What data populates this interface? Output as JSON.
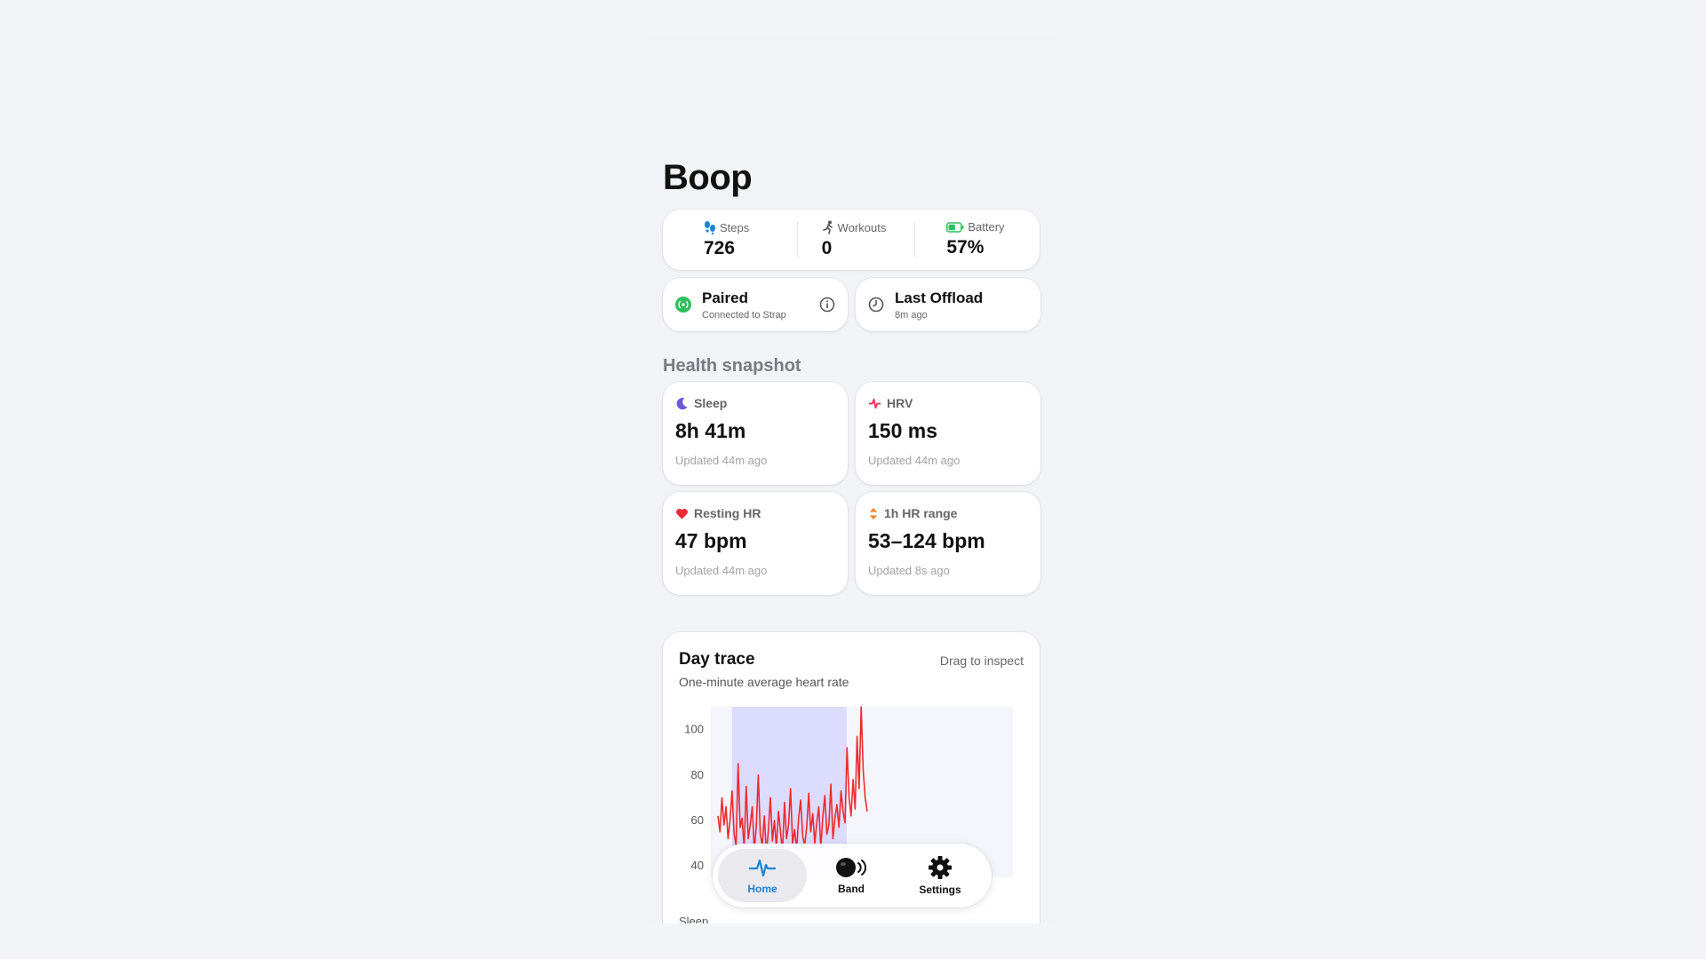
{
  "app": {
    "title": "Boop"
  },
  "stats": [
    {
      "label": "Steps",
      "value": "726",
      "icon": "footprints-icon"
    },
    {
      "label": "Workouts",
      "value": "0",
      "icon": "runner-icon"
    },
    {
      "label": "Battery",
      "value": "57%",
      "icon": "battery-icon",
      "level": 0.57
    }
  ],
  "status": {
    "paired": {
      "title": "Paired",
      "subtitle": "Connected to Strap"
    },
    "offload": {
      "title": "Last Offload",
      "subtitle": "8m ago"
    }
  },
  "health": {
    "section_title": "Health snapshot",
    "sleep": {
      "label": "Sleep",
      "value": "8h 41m",
      "updated": "Updated 44m ago"
    },
    "hrv": {
      "label": "HRV",
      "value": "150 ms",
      "updated": "Updated 44m ago"
    },
    "resting_hr": {
      "label": "Resting HR",
      "value": "47 bpm",
      "updated": "Updated 44m ago"
    },
    "hr_range": {
      "label": "1h HR range",
      "value": "53–124 bpm",
      "updated": "Updated 8s ago"
    }
  },
  "day_trace": {
    "title": "Day trace",
    "subtitle": "One-minute average heart rate",
    "hint": "Drag to inspect",
    "sleep_label": "Sleep"
  },
  "chart_data": {
    "type": "line",
    "series": [
      {
        "values": [
          62,
          55,
          70,
          58,
          66,
          52,
          60,
          73,
          54,
          49,
          85,
          57,
          61,
          48,
          75,
          52,
          58,
          66,
          47,
          57,
          80,
          54,
          49,
          62,
          45,
          56,
          70,
          51,
          60,
          48,
          64,
          55,
          46,
          68,
          52,
          58,
          74,
          50,
          56,
          47,
          61,
          69,
          53,
          49,
          57,
          72,
          55,
          63,
          50,
          59,
          66,
          48,
          62,
          71,
          54,
          58,
          76,
          52,
          61,
          67,
          57,
          73,
          64,
          59,
          92,
          70,
          62,
          78,
          65,
          97,
          74,
          110,
          82,
          70,
          64
        ]
      }
    ],
    "ylim": [
      35,
      110
    ],
    "yticks": [
      100,
      80,
      60,
      40
    ],
    "sleep_region": [
      0.07,
      0.45
    ],
    "grid": false
  },
  "nav": [
    {
      "label": "Home",
      "icon": "heartbeat-icon",
      "active": true
    },
    {
      "label": "Band",
      "icon": "band-icon",
      "active": false
    },
    {
      "label": "Settings",
      "icon": "gear-icon",
      "active": false
    }
  ],
  "colors": {
    "accent": "#1a84d8",
    "trace": "#ef2b2f",
    "sleep_band": "#dcdcff"
  }
}
